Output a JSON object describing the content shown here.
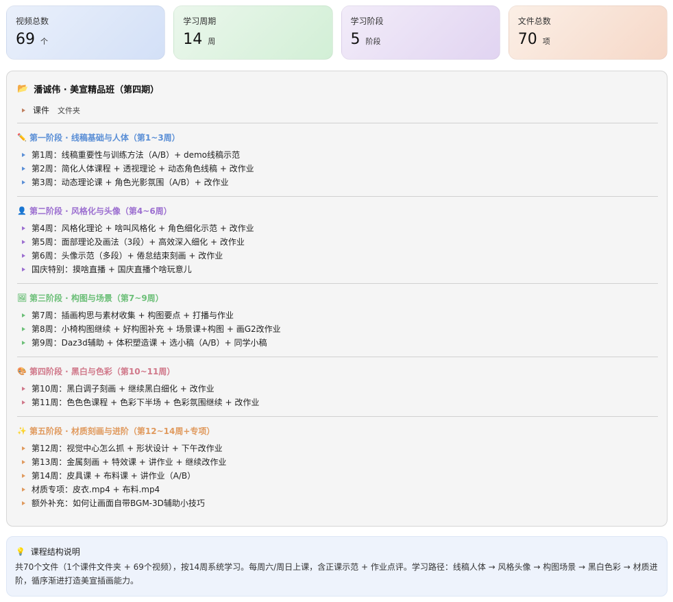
{
  "stats": [
    {
      "label": "视频总数",
      "value": "69",
      "unit": "个"
    },
    {
      "label": "学习周期",
      "value": "14",
      "unit": "周"
    },
    {
      "label": "学习阶段",
      "value": "5",
      "unit": "阶段"
    },
    {
      "label": "文件总数",
      "value": "70",
      "unit": "项"
    }
  ],
  "root": {
    "icon": "📂",
    "title": "潘诚伟 · 美宣精品班（第四期）"
  },
  "folder": {
    "label": "课件",
    "tag": "文件夹"
  },
  "stages": [
    {
      "icon": "✏️",
      "title": "第一阶段 · 线稿基础与人体（第1~3周）",
      "color": "#5b8fd6",
      "items": [
        "第1周：线稿重要性与训练方法（A/B）+ demo线稿示范",
        "第2周：简化人体课程 + 透视理论 + 动态角色线稿 + 改作业",
        "第3周：动态理论课 + 角色光影氛围（A/B）+ 改作业"
      ]
    },
    {
      "icon": "👤",
      "title": "第二阶段 · 风格化与头像（第4~6周）",
      "color": "#9c6fd0",
      "items": [
        "第4周：风格化理论 + 啥叫风格化 + 角色细化示范 + 改作业",
        "第5周：面部理论及画法（3段）+ 高效深入细化 + 改作业",
        "第6周：头像示范（多段）+ 倦怠结束刻画 + 改作业",
        "国庆特别：摸啥直播 + 国庆直播个啥玩意儿"
      ]
    },
    {
      "icon": "🖼",
      "title": "第三阶段 · 构图与场景（第7~9周）",
      "color": "#6cbf78",
      "items": [
        "第7周：插画构思与素材收集 + 构图要点 + 打播与作业",
        "第8周：小椅构图继续 + 好构图补充 + 场景课+构图 + 画G2改作业",
        "第9周：Daz3d辅助 + 体积塑造课 + 选小稿（A/B）+ 同学小稿"
      ]
    },
    {
      "icon": "🎨",
      "title": "第四阶段 · 黑白与色彩（第10~11周）",
      "color": "#d0788a",
      "items": [
        "第10周：黑白调子刻画 + 继续黑白细化 + 改作业",
        "第11周：色色色课程 + 色彩下半场 + 色彩氛围继续 + 改作业"
      ]
    },
    {
      "icon": "✨",
      "title": "第五阶段 · 材质刻画与进阶（第12~14周+专项）",
      "color": "#e09a5e",
      "items": [
        "第12周：视觉中心怎么抓 + 形状设计 + 下午改作业",
        "第13周：金属刻画 + 特效课 + 讲作业 + 继续改作业",
        "第14周：皮具课 + 布料课 + 讲作业（A/B）",
        "材质专项：皮衣.mp4 + 布料.mp4",
        "额外补充：如何让画面自带BGM-3D辅助小技巧"
      ]
    }
  ],
  "note": {
    "icon": "💡",
    "title": "课程结构说明",
    "body": "共70个文件（1个课件文件夹 + 69个视频），按14周系统学习。每周六/周日上课，含正课示范 + 作业点评。学习路径：线稿人体 → 风格头像 → 构图场景 → 黑白色彩 → 材质进阶，循序渐进打造美宣插画能力。"
  }
}
